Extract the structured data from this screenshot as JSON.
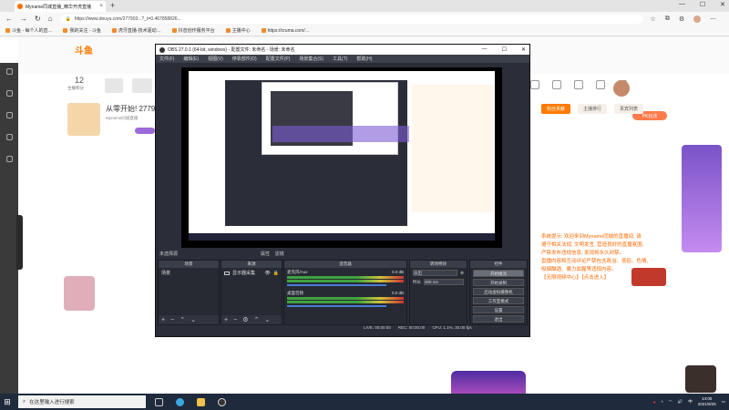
{
  "browser": {
    "tab_title": "Myname同城直播_精华开虎直播",
    "tab_close": "×",
    "new_tab": "+",
    "url": "https://www.douyu.com/277903...?_t=0.467858826...",
    "bookmarks": [
      "斗鱼 - 每个人的直…",
      "我的关注 - 斗鱼",
      "虎牙直播-技术驱动…",
      "抖音创作服务平台",
      "主播中心",
      "https://cruma.com/…"
    ]
  },
  "page": {
    "logo": "斗鱼",
    "stat_num": "12",
    "stat_label": "主播积分",
    "streamer_name": "从零开始! 2779",
    "streamer_sub": "Myname同城直播",
    "pk_label": "PK玩法",
    "chat_tabs": [
      "粉丝贡献",
      "主播排行",
      "贵宾列表"
    ],
    "chat_lines": [
      "系统提示: 欢迎来到Myname同城的直播间, 请",
      "遵守相关法规, 文明发言, 营造良好的直播氛围,",
      "严禁发布违规信息, 发现将永久封禁。",
      "直播内容和互动评论严禁包含政治、低俗、色情、",
      "吸烟酗酒、暴力血腥等违规内容。"
    ],
    "chat_footer": "【无限视频中心】【点击进入】",
    "promo_bottom": "试玩送礼"
  },
  "obs": {
    "title": "OBS 27.0.1 (64-bit, windows) - 配置文件: 未命名 - 场景: 未命名",
    "menu": [
      "文件(F)",
      "编辑(E)",
      "视图(V)",
      "停靠部件(D)",
      "配置文件(P)",
      "场景集合(S)",
      "工具(T)",
      "帮助(H)"
    ],
    "scene_label": "未选择源",
    "props_label": "属性",
    "filters_label": "滤镜",
    "docks": {
      "scenes": {
        "title": "场景",
        "items": [
          "场景"
        ]
      },
      "sources": {
        "title": "来源",
        "items": [
          "显示器采集"
        ]
      },
      "mixer": {
        "title": "混音器",
        "channels": [
          {
            "name": "麦克风/Aux",
            "db": "0.0 dB"
          },
          {
            "name": "桌面音频",
            "db": "0.0 dB"
          }
        ]
      },
      "transitions": {
        "title": "转场特效",
        "type": "淡出",
        "duration_label": "时长",
        "duration": "300 ms"
      },
      "controls": {
        "title": "控件",
        "buttons": [
          "开始推流",
          "开始录制",
          "启动虚拟摄像机",
          "工作室模式",
          "设置",
          "退出"
        ]
      }
    },
    "status": [
      "LIVE: 00:00:00",
      "REC: 00:00:00",
      "CPU: 1.1%, 30.00 fps"
    ]
  },
  "taskbar": {
    "search_placeholder": "在这里输入进行搜索",
    "time": "14:05",
    "date": "2021/9/25"
  },
  "colors": {
    "accent": "#ff7a00",
    "obs_bg": "#2b2e38",
    "taskbar": "#1f2a3c"
  }
}
